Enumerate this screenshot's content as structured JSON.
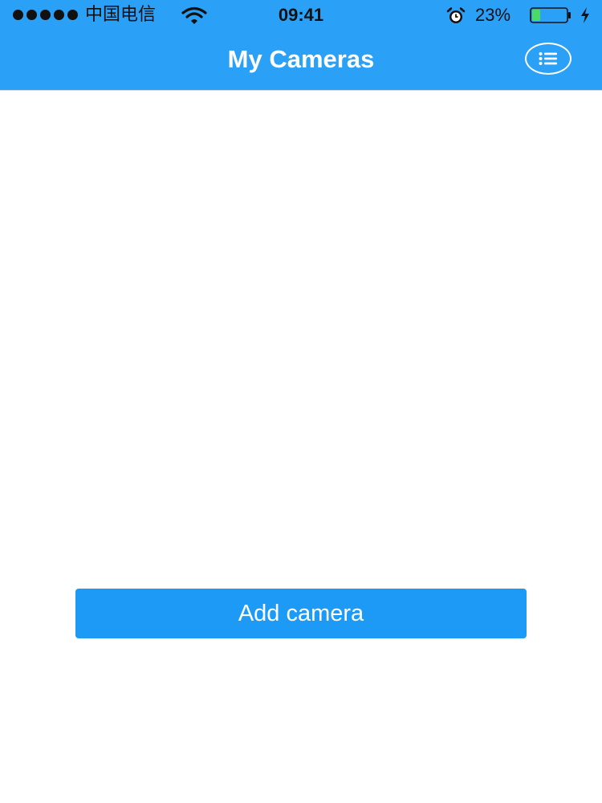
{
  "status_bar": {
    "signal_bars": 5,
    "carrier": "中国电信",
    "wifi_icon": "wifi-icon",
    "time": "09:41",
    "alarm_icon": "alarm-clock-icon",
    "battery_percent_label": "23%",
    "battery_level": 0.23,
    "battery_color": "#4cd964",
    "charging_icon": "bolt-icon"
  },
  "nav_bar": {
    "title": "My Cameras",
    "menu_icon": "list-icon",
    "background_color": "#2aa0f7"
  },
  "main": {
    "add_camera_label": "Add camera",
    "button_color": "#1c9af6"
  }
}
